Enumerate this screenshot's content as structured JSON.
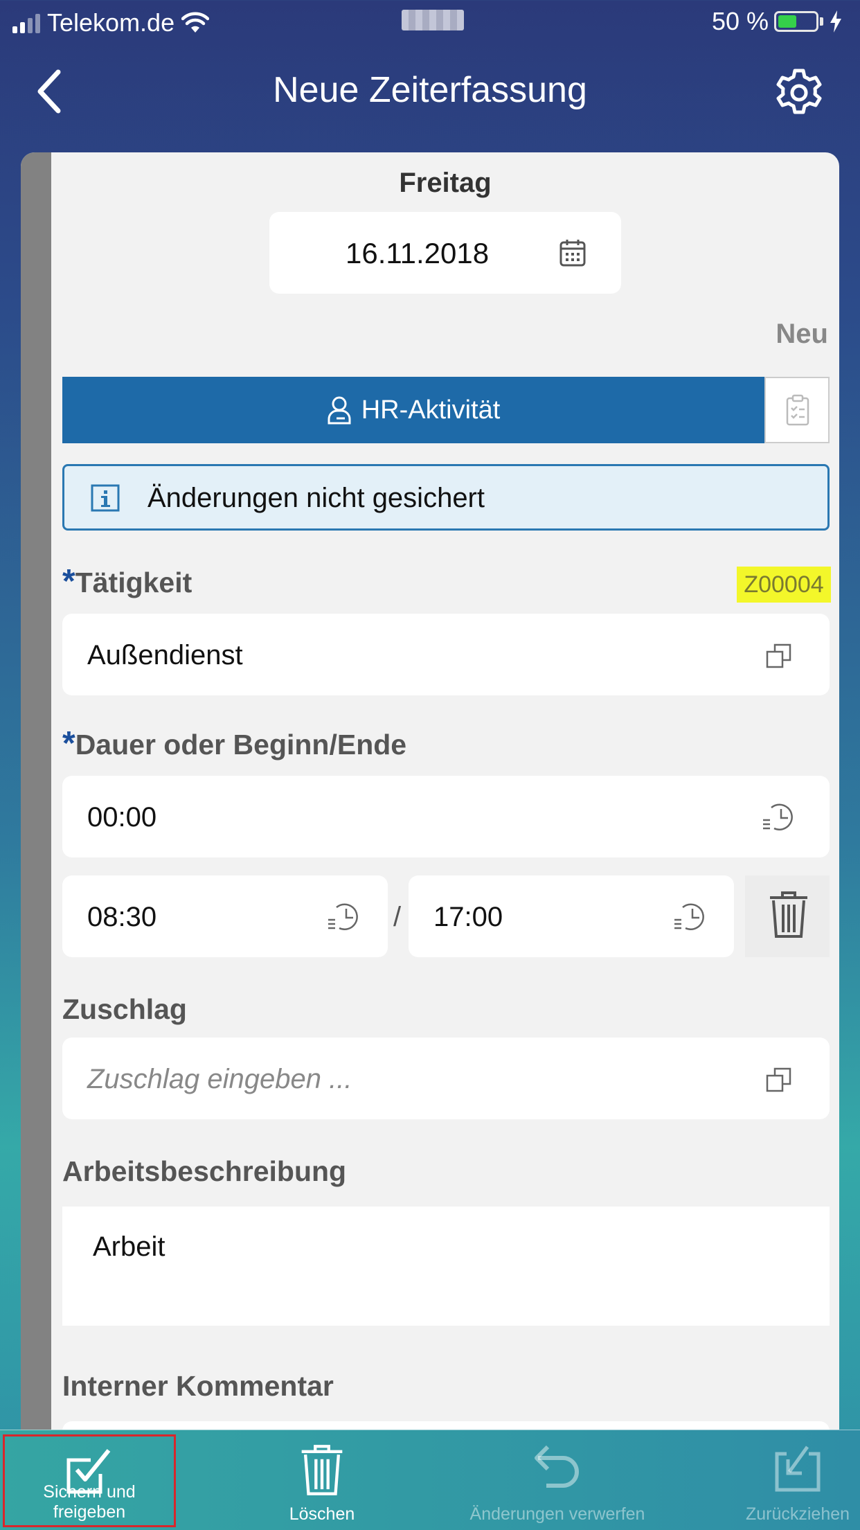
{
  "status_bar": {
    "carrier": "Telekom.de",
    "battery": "50 %",
    "battery_level": 0.5
  },
  "nav": {
    "title": "Neue Zeiterfassung",
    "back_icon": "chevron-left-icon",
    "settings_icon": "gear-icon"
  },
  "form": {
    "weekday": "Freitag",
    "date": "16.11.2018",
    "status": "Neu",
    "hr_activity_label": "HR-Aktivität",
    "info_message": "Änderungen nicht gesichert",
    "activity": {
      "required_mark": "*",
      "label": "Tätigkeit",
      "code": "Z00004",
      "value": "Außendienst"
    },
    "duration": {
      "required_mark": "*",
      "label": "Dauer oder Beginn/Ende",
      "value": "00:00",
      "start": "08:30",
      "separator": "/",
      "end": "17:00"
    },
    "surcharge": {
      "label": "Zuschlag",
      "placeholder": "Zuschlag eingeben ..."
    },
    "work_description": {
      "label": "Arbeitsbeschreibung",
      "value": "Arbeit"
    },
    "internal_comment": {
      "label": "Interner Kommentar"
    }
  },
  "toolbar": {
    "save_release": "Sichern und freigeben",
    "delete": "Löschen",
    "discard": "Änderungen verwerfen",
    "withdraw": "Zurückziehen"
  },
  "colors": {
    "hr_button": "#1e6aa8",
    "info_bg": "#e3f0f8",
    "highlight": "#f3f72a",
    "required": "#1b4f9c"
  }
}
